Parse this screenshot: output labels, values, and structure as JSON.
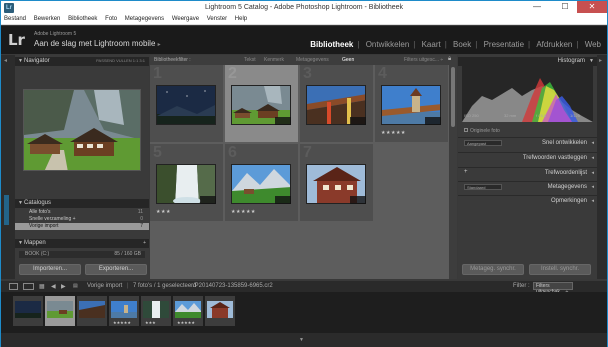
{
  "window": {
    "title": "Lightroom 5 Catalog - Adobe Photoshop Lightroom - Bibliotheek",
    "app_icon": "Lr",
    "minimize": "—",
    "maximize": "☐",
    "close": "✕"
  },
  "menu": [
    "Bestand",
    "Bewerken",
    "Bibliotheek",
    "Foto",
    "Metagegevens",
    "Weergave",
    "Venster",
    "Help"
  ],
  "identity": {
    "logo": "Lr",
    "product": "Adobe Lightroom 5",
    "name": "Aan de slag met Lightroom mobile",
    "name_arrow": "▸"
  },
  "modules": [
    "Bibliotheek",
    "Ontwikkelen",
    "Kaart",
    "Boek",
    "Presentatie",
    "Afdrukken",
    "Web"
  ],
  "active_module": "Bibliotheek",
  "left": {
    "navigator": {
      "title": "Navigator",
      "options": "PASSEND  VULLEN  1:1  3:1"
    },
    "catalog": {
      "title": "Catalogus",
      "items": [
        {
          "label": "Alle foto's",
          "count": "11"
        },
        {
          "label": "Snelle verzameling +",
          "count": "0"
        },
        {
          "label": "Vorige import",
          "count": "7"
        }
      ]
    },
    "folders": {
      "title": "Mappen",
      "drive": "BOOK (C:)",
      "drive_info": "85 / 160 GB"
    },
    "import_button": "Importeren...",
    "export_button": "Exporteren..."
  },
  "library_filter": {
    "label": "Bibliotheekfilter :",
    "filters": [
      "Tekst",
      "Kenmerk",
      "Metagegevens",
      "Geen"
    ],
    "active": "Geen",
    "preset": "Filters uitgesc... ÷"
  },
  "grid": {
    "cells": [
      {
        "num": "1",
        "stars": "",
        "selected": false
      },
      {
        "num": "2",
        "stars": "",
        "selected": true
      },
      {
        "num": "3",
        "stars": "",
        "selected": false
      },
      {
        "num": "4",
        "stars": "★★★★★",
        "selected": false
      },
      {
        "num": "5",
        "stars": "★★★",
        "selected": false
      },
      {
        "num": "6",
        "stars": "★★★★★",
        "selected": false
      },
      {
        "num": "7",
        "stars": "",
        "selected": false
      }
    ]
  },
  "right": {
    "histogram_title": "Histogram",
    "hist_info": [
      "ISO 250",
      "32 mm",
      "f / 5,6",
      "1/125"
    ],
    "original_photo": "Originele foto",
    "rows": [
      {
        "select": "Aangepast",
        "label": "Snel ontwikkelen"
      },
      {
        "select": "",
        "label": "Trefwoorden vastleggen"
      },
      {
        "select": "+",
        "label": "Trefwoordenlijst"
      },
      {
        "select": "Standaard",
        "label": "Metagegevens"
      },
      {
        "select": "",
        "label": "Opmerkingen"
      }
    ],
    "sync_meta_button": "Metageg. synchr.",
    "sync_settings_button": "Instell. synchr."
  },
  "toolbar": {
    "source": "Vorige import",
    "count": "7 foto's / 1 geselecteerd",
    "file": "/P20140723-135859-6965.cr2",
    "filter_label": "Filter :",
    "filter_value": "Filters uitgeschak... ÷",
    "page1": "1",
    "page2": "2"
  },
  "filmstrip": {
    "items": [
      {
        "stars": ""
      },
      {
        "stars": ""
      },
      {
        "stars": ""
      },
      {
        "stars": "★★★★★"
      },
      {
        "stars": "★★★"
      },
      {
        "stars": "★★★★★"
      },
      {
        "stars": ""
      }
    ]
  },
  "colors": {
    "accent_border": "#1e8bc9",
    "panel_bg": "#3a3a3a",
    "grid_bg": "#5d5d5d",
    "identity_bg": "#1a1a1a"
  }
}
